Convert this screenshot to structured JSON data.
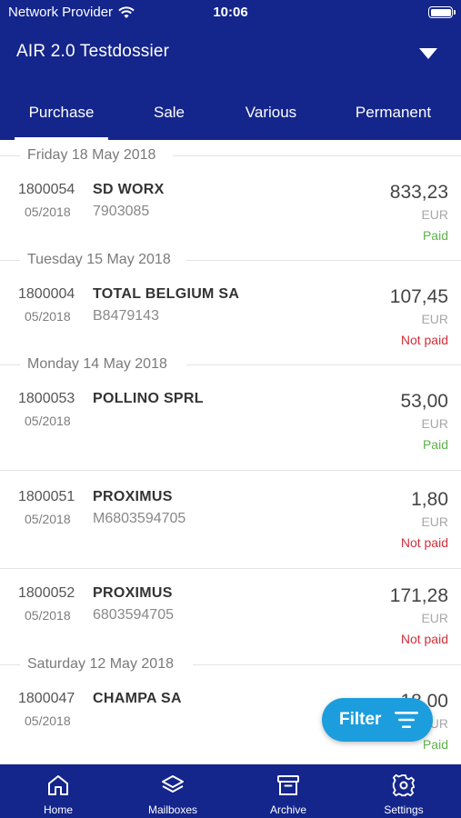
{
  "status_bar": {
    "carrier": "Network Provider",
    "time": "10:06"
  },
  "header": {
    "title": "AIR 2.0 Testdossier"
  },
  "tabs": [
    {
      "label": "Purchase"
    },
    {
      "label": "Sale"
    },
    {
      "label": "Various"
    },
    {
      "label": "Permanent"
    }
  ],
  "groups": [
    {
      "date": "Friday 18 May 2018"
    },
    {
      "date": "Tuesday 15 May 2018"
    },
    {
      "date": "Monday 14 May 2018"
    },
    {
      "date": "Saturday 12 May 2018"
    }
  ],
  "rows": [
    {
      "number": "1800054",
      "period": "05/2018",
      "name": "SD WORX",
      "ref": "7903085",
      "amount": "833,23",
      "currency": "EUR",
      "status": "Paid"
    },
    {
      "number": "1800004",
      "period": "05/2018",
      "name": "TOTAL BELGIUM SA",
      "ref": "B8479143",
      "amount": "107,45",
      "currency": "EUR",
      "status": "Not paid"
    },
    {
      "number": "1800053",
      "period": "05/2018",
      "name": "POLLINO SPRL",
      "ref": "",
      "amount": "53,00",
      "currency": "EUR",
      "status": "Paid"
    },
    {
      "number": "1800051",
      "period": "05/2018",
      "name": "PROXIMUS",
      "ref": "M6803594705",
      "amount": "1,80",
      "currency": "EUR",
      "status": "Not paid"
    },
    {
      "number": "1800052",
      "period": "05/2018",
      "name": "PROXIMUS",
      "ref": "6803594705",
      "amount": "171,28",
      "currency": "EUR",
      "status": "Not paid"
    },
    {
      "number": "1800047",
      "period": "05/2018",
      "name": "CHAMPA SA",
      "ref": "",
      "amount": "18,00",
      "currency": "EUR",
      "status": "Paid"
    }
  ],
  "filter_button": {
    "label": "Filter"
  },
  "bottom_nav": [
    {
      "label": "Home",
      "icon": "home-icon"
    },
    {
      "label": "Mailboxes",
      "icon": "layers-icon"
    },
    {
      "label": "Archive",
      "icon": "archive-icon"
    },
    {
      "label": "Settings",
      "icon": "gear-icon"
    }
  ],
  "colors": {
    "brand": "#14258c",
    "accent": "#1c9ddd",
    "paid": "#5cb24a",
    "not_paid": "#d2303b"
  }
}
